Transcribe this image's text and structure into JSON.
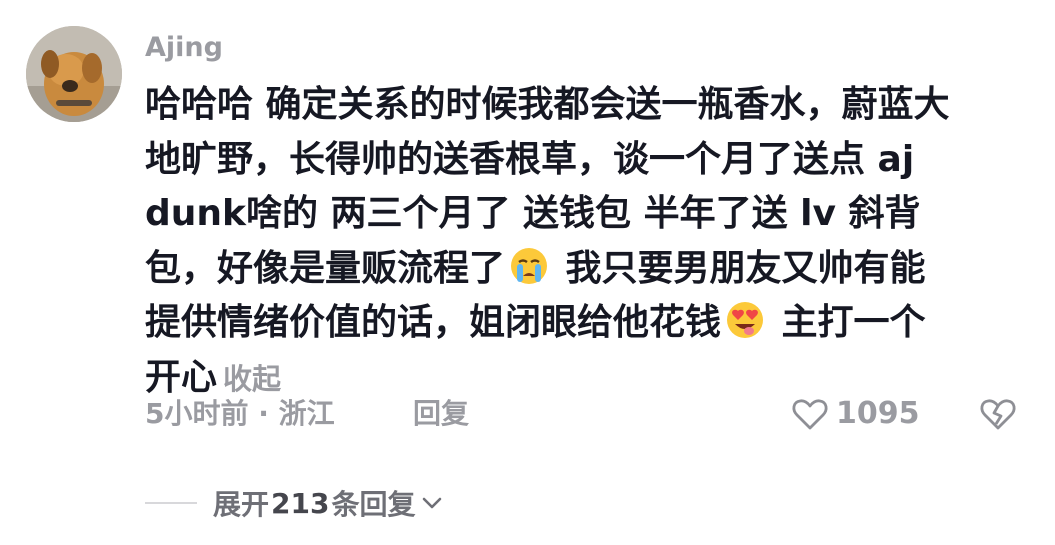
{
  "comment": {
    "username": "Ajing",
    "lines": [
      "哈哈哈 确定关系的时候我都会送一瓶香水，蔚蓝大",
      "地旷野，长得帅的送香根草，谈一个月了送点 aj",
      "dunk啥的 两三个月了 送钱包 半年了送 lv 斜背",
      "包，好像是量贩流程了",
      " 我只要男朋友又帅有能",
      "提供情绪价值的话，姐闭眼给他花钱",
      " 主打一个",
      "开心"
    ],
    "collapse_label": "收起",
    "emojis": [
      "crying-emoji",
      "heart-eyes-emoji"
    ]
  },
  "meta": {
    "time_location": "5小时前 · 浙江",
    "reply_label": "回复",
    "like_count": "1095"
  },
  "replies": {
    "expand_prefix": "展开",
    "count": "213",
    "expand_suffix": "条回复"
  },
  "colors": {
    "text": "#161823",
    "muted": "#9a9ba1",
    "expand": "#6e6f76"
  },
  "icons": {
    "like": "heart-outline-icon",
    "dislike": "broken-heart-icon",
    "expand": "chevron-down-icon"
  }
}
